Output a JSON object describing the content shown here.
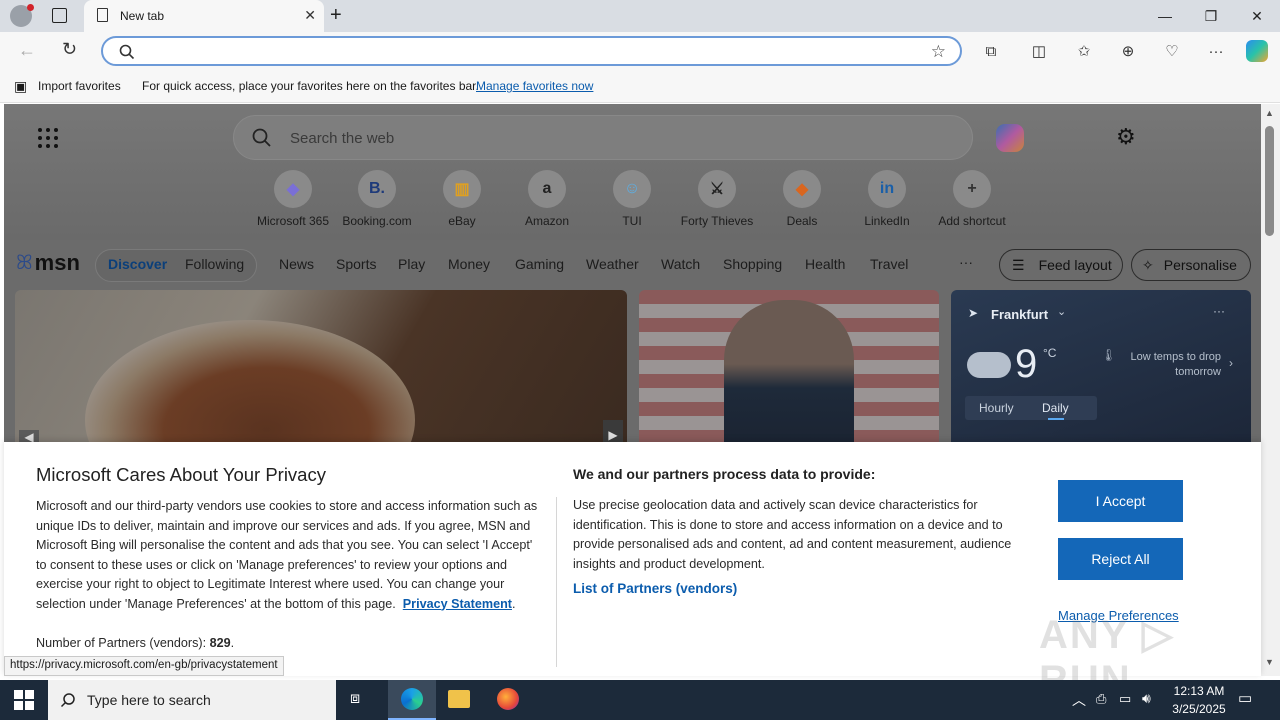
{
  "browser": {
    "tab_title": "New tab",
    "favbar": {
      "import_label": "Import favorites",
      "hint": "For quick access, place your favorites here on the favorites bar.",
      "manage_link": "Manage favorites now"
    }
  },
  "msn": {
    "search_placeholder": "Search the web",
    "shortcuts": [
      {
        "label": "Microsoft 365",
        "glyph": "◆",
        "color": "#7a6fd6"
      },
      {
        "label": "Booking.com",
        "glyph": "B.",
        "color": "#1e3a7a"
      },
      {
        "label": "eBay",
        "glyph": "▥",
        "color": "#e0a020"
      },
      {
        "label": "Amazon",
        "glyph": "a",
        "color": "#222222"
      },
      {
        "label": "TUI",
        "glyph": "☺",
        "color": "#5ab0e8"
      },
      {
        "label": "Forty Thieves",
        "glyph": "⚔",
        "color": "#222222"
      },
      {
        "label": "Deals",
        "glyph": "◆",
        "color": "#d9661f"
      },
      {
        "label": "LinkedIn",
        "glyph": "in",
        "color": "#1a5fa8"
      },
      {
        "label": "Add shortcut",
        "glyph": "+",
        "color": "#333333"
      }
    ],
    "logo": "msn",
    "nav": {
      "discover": "Discover",
      "following": "Following",
      "items": [
        "News",
        "Sports",
        "Play",
        "Money",
        "Gaming",
        "Weather",
        "Watch",
        "Shopping",
        "Health",
        "Travel"
      ],
      "more": "···",
      "feed_layout": "Feed layout",
      "personalise": "Personalise"
    },
    "weather": {
      "city": "Frankfurt",
      "temp": "9",
      "unit": "°C",
      "alert": "Low temps to drop tomorrow",
      "tab_hourly": "Hourly",
      "tab_daily": "Daily"
    }
  },
  "privacy": {
    "title": "Microsoft Cares About Your Privacy",
    "body": "Microsoft and our third-party vendors use cookies to store and access information such as unique IDs to deliver, maintain and improve our services and ads. If you agree, MSN and Microsoft Bing will personalise the content and ads that you see. You can select 'I Accept' to consent to these uses or click on 'Manage preferences' to review your options and exercise your right to object to Legitimate Interest where used.  You can change your selection under 'Manage Preferences' at the bottom of this page.",
    "privacy_link": "Privacy Statement",
    "partners_label": "Number of Partners (vendors):",
    "partners_count": "829",
    "right_title": "We and our partners process data to provide:",
    "right_body": "Use precise geolocation data and actively scan device characteristics for identification. This is done to store and access information on a device and to provide personalised ads and content, ad and content measurement, audience insights and product development.",
    "list_partners": "List of Partners (vendors)",
    "accept": "I Accept",
    "reject": "Reject All",
    "manage": "Manage Preferences"
  },
  "status_url": "https://privacy.microsoft.com/en-gb/privacystatement",
  "taskbar": {
    "search_placeholder": "Type here to search",
    "time": "12:13 AM",
    "date": "3/25/2025"
  },
  "colors": {
    "accent": "#1467b8",
    "link": "#0b5cad"
  }
}
